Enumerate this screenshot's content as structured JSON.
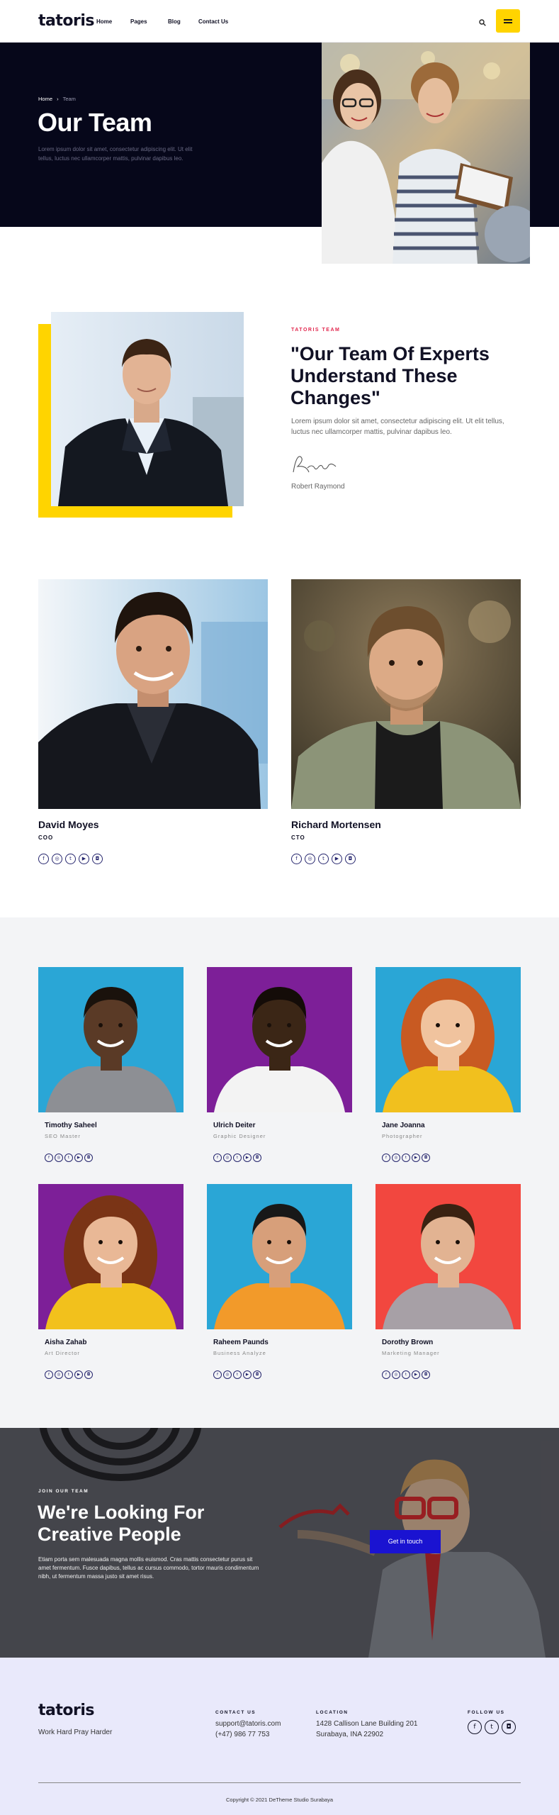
{
  "header": {
    "logo": "tatoris",
    "nav": [
      "Home",
      "Pages",
      "Blog",
      "Contact Us"
    ],
    "search_icon": "search-icon",
    "menu_icon": "hamburger-icon",
    "accent": "#ffd400"
  },
  "hero": {
    "breadcrumb_home": "Home",
    "breadcrumb_sep": "›",
    "breadcrumb_current": "Team",
    "title": "Our Team",
    "text": "Lorem ipsum dolor sit amet, consectetur adipiscing elit. Ut elit tellus, luctus nec ullamcorper mattis, pulvinar dapibus leo."
  },
  "about": {
    "eyebrow": "TATORIS TEAM",
    "quote_line1": "\"Our Team Of Experts",
    "quote_line2": "Understand These",
    "quote_line3": "Changes\"",
    "text": "Lorem ipsum dolor sit amet, consectetur adipiscing elit. Ut elit tellus, luctus nec ullamcorper mattis, pulvinar dapibus leo.",
    "signature": "Rayon",
    "author": "Robert Raymond",
    "accent": "#ffd400"
  },
  "leaders": [
    {
      "name": "David Moyes",
      "role": "COO"
    },
    {
      "name": "Richard Mortensen",
      "role": "CTO"
    }
  ],
  "social_icons": [
    "facebook-icon",
    "dribbble-icon",
    "twitter-icon",
    "youtube-icon",
    "instagram-icon"
  ],
  "team": [
    {
      "name": "Timothy Saheel",
      "role": "SEO Master",
      "bg": "#2aa6d6"
    },
    {
      "name": "Ulrich Deiter",
      "role": "Graphic Designer",
      "bg": "#7d1f98"
    },
    {
      "name": "Jane Joanna",
      "role": "Photographer",
      "bg": "#2aa6d6"
    },
    {
      "name": "Aisha Zahab",
      "role": "Art Director",
      "bg": "#7d1f98"
    },
    {
      "name": "Raheem Paunds",
      "role": "Business Analyze",
      "bg": "#2aa6d6"
    },
    {
      "name": "Dorothy Brown",
      "role": "Marketing Manager",
      "bg": "#f2473f"
    }
  ],
  "join": {
    "eyebrow": "JOIN OUR TEAM",
    "title_line1": "We're Looking For",
    "title_line2": "Creative People",
    "text": "Etiam porta sem malesuada magna mollis euismod. Cras mattis consectetur purus sit amet fermentum. Fusce dapibus, tellus ac cursus commodo, tortor mauris condimentum nibh, ut fermentum massa justo sit amet risus.",
    "button": "Get in touch",
    "button_color": "#1a13d1"
  },
  "footer": {
    "logo": "tatoris",
    "tagline": "Work Hard Pray Harder",
    "contact_heading": "CONTACT US",
    "email": "support@tatoris.com",
    "phone": "(+47) 986 77 753",
    "location_heading": "LOCATION",
    "address1": "1428 Callison Lane Building 201",
    "address2": "Surabaya, INA 22902",
    "follow_heading": "FOLLOW US",
    "copyright": "Copyright © 2021 DeTheme Studio Surabaya",
    "bg": "#e9e9fb"
  }
}
